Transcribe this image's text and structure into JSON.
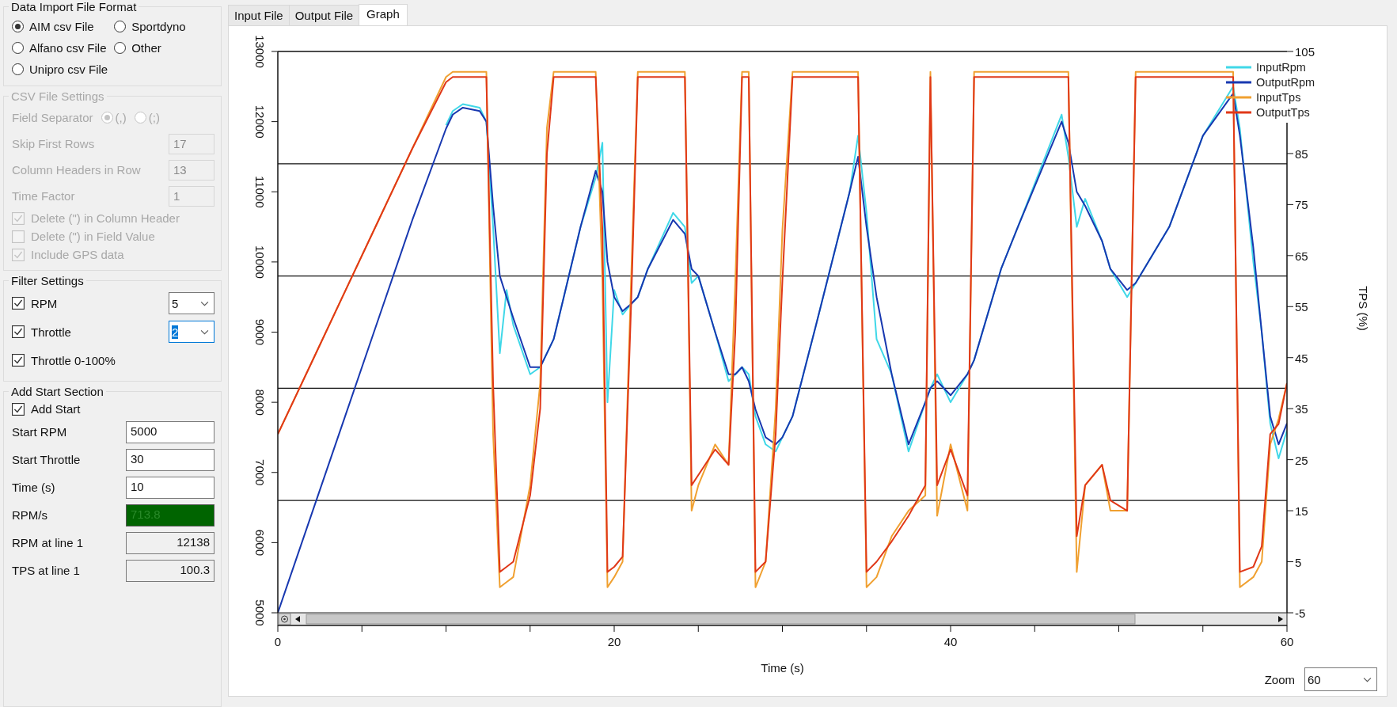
{
  "import_format": {
    "title": "Data Import File Format",
    "options": [
      {
        "label": "AIM csv File",
        "selected": true
      },
      {
        "label": "Sportdyno",
        "selected": false
      },
      {
        "label": "Alfano csv File",
        "selected": false
      },
      {
        "label": "Other",
        "selected": false
      },
      {
        "label": "Unipro csv File",
        "selected": false
      }
    ]
  },
  "csv_settings": {
    "title": "CSV File Settings",
    "disabled": true,
    "field_separator": {
      "label": "Field Separator",
      "options": [
        {
          "label": "(,)",
          "selected": true
        },
        {
          "label": "(;)",
          "selected": false
        }
      ]
    },
    "fields": [
      {
        "label": "Skip First Rows",
        "value": "17"
      },
      {
        "label": "Column Headers in Row",
        "value": "13"
      },
      {
        "label": "Time Factor",
        "value": "1"
      }
    ],
    "checkboxes": [
      {
        "label": "Delete (\") in Column Header",
        "checked": true
      },
      {
        "label": "Delete (\") in Field Value",
        "checked": false
      },
      {
        "label": "Include GPS data",
        "checked": true
      }
    ]
  },
  "filter_settings": {
    "title": "Filter Settings",
    "rows": [
      {
        "label": "RPM",
        "checked": true,
        "value": "5",
        "focused": false
      },
      {
        "label": "Throttle",
        "checked": true,
        "value": "2",
        "focused": true
      },
      {
        "label": "Throttle 0-100%",
        "checked": true
      }
    ]
  },
  "start_section": {
    "title": "Add Start Section",
    "add_start": {
      "label": "Add Start",
      "checked": true
    },
    "fields": [
      {
        "label": "Start RPM",
        "value": "5000",
        "kind": "input"
      },
      {
        "label": "Start Throttle",
        "value": "30",
        "kind": "input"
      },
      {
        "label": "Time (s)",
        "value": "10",
        "kind": "input"
      },
      {
        "label": "RPM/s",
        "value": "713.8",
        "kind": "highlight"
      },
      {
        "label": "RPM at line 1",
        "value": "12138",
        "kind": "readonly"
      },
      {
        "label": "TPS at line 1",
        "value": "100.3",
        "kind": "readonly"
      }
    ]
  },
  "tabs": [
    {
      "label": "Input File",
      "selected": false
    },
    {
      "label": "Output File",
      "selected": false
    },
    {
      "label": "Graph",
      "selected": true
    }
  ],
  "graph": {
    "chart_data": {
      "type": "line",
      "legend": "top-right",
      "xlabel": "Time (s)",
      "y2label": "TPS (%)",
      "xlim": [
        0,
        60
      ],
      "xticks": [
        0,
        20,
        40,
        60
      ],
      "ylim": [
        5000,
        13000
      ],
      "yticks": [
        5000,
        6000,
        7000,
        8000,
        9000,
        10000,
        11000,
        12000,
        13000
      ],
      "y2lim": [
        -5,
        105
      ],
      "y2ticks": [
        -5,
        5,
        15,
        25,
        35,
        45,
        55,
        65,
        75,
        85,
        105
      ],
      "x": [
        0,
        2,
        4,
        6,
        8,
        10,
        10.4,
        11,
        12,
        12.4,
        12.8,
        13.2,
        13.6,
        14,
        15,
        15.6,
        16,
        16.4,
        17,
        18,
        18.9,
        19.3,
        19.6,
        20,
        20.5,
        21,
        21.4,
        22,
        23.5,
        24.2,
        24.6,
        25,
        26,
        26.8,
        27.2,
        27.6,
        28,
        28.4,
        29,
        29.6,
        30,
        30.6,
        32,
        34,
        34.5,
        35,
        35.6,
        36.5,
        37.5,
        38.5,
        38.8,
        39.2,
        40,
        41,
        41.4,
        43,
        44,
        46.6,
        47,
        47.5,
        48,
        49,
        49.5,
        50.5,
        51,
        53,
        55,
        56.8,
        57.2,
        58,
        58.5,
        59,
        59.5,
        60
      ],
      "series": [
        {
          "name": "InputRpm",
          "color": "#40d8e8",
          "values": [
            null,
            null,
            null,
            null,
            null,
            11950,
            12150,
            12250,
            12200,
            12000,
            10500,
            8700,
            9600,
            9100,
            8400,
            8500,
            8700,
            8900,
            9500,
            10500,
            11200,
            11700,
            8000,
            9600,
            9250,
            9400,
            9500,
            9900,
            10700,
            10500,
            9700,
            9800,
            9000,
            8300,
            8400,
            8500,
            8400,
            7800,
            7400,
            7300,
            7500,
            7800,
            9100,
            11000,
            11800,
            10700,
            8900,
            8400,
            7300,
            8000,
            8200,
            8400,
            8000,
            8400,
            8600,
            9900,
            10500,
            12100,
            11500,
            10500,
            10900,
            10300,
            9900,
            9500,
            9700,
            10500,
            11800,
            12500,
            11900,
            10000,
            9000,
            7700,
            7200,
            7600
          ]
        },
        {
          "name": "OutputRpm",
          "color": "#1838b0",
          "values": [
            5000,
            6400,
            7800,
            9200,
            10600,
            11900,
            12100,
            12200,
            12150,
            12000,
            10800,
            9800,
            9500,
            9200,
            8500,
            8500,
            8700,
            8900,
            9500,
            10500,
            11300,
            11000,
            10000,
            9500,
            9300,
            9400,
            9500,
            9900,
            10600,
            10400,
            9900,
            9800,
            9000,
            8400,
            8400,
            8500,
            8300,
            7900,
            7500,
            7400,
            7500,
            7800,
            9100,
            11000,
            11500,
            10500,
            9500,
            8400,
            7400,
            8000,
            8200,
            8300,
            8100,
            8400,
            8600,
            9900,
            10500,
            12000,
            11700,
            11000,
            10800,
            10300,
            9900,
            9600,
            9700,
            10500,
            11800,
            12400,
            11800,
            10200,
            9000,
            7800,
            7400,
            7700
          ]
        },
        {
          "name": "InputTps",
          "color": "#f0a030",
          "axis": "y2",
          "values": [
            30,
            44,
            58,
            72,
            86,
            100,
            101,
            101,
            101,
            101,
            30,
            0,
            1,
            2,
            20,
            40,
            90,
            101,
            101,
            101,
            101,
            60,
            0,
            2,
            5,
            60,
            101,
            101,
            101,
            101,
            15,
            20,
            28,
            24,
            60,
            101,
            101,
            0,
            5,
            35,
            70,
            101,
            101,
            101,
            101,
            0,
            2,
            10,
            15,
            18,
            101,
            14,
            28,
            15,
            101,
            101,
            101,
            101,
            101,
            3,
            20,
            24,
            15,
            15,
            101,
            101,
            101,
            101,
            0,
            2,
            5,
            28,
            33,
            40
          ]
        },
        {
          "name": "OutputTps",
          "color": "#e03818",
          "axis": "y2",
          "values": [
            30,
            44,
            58,
            72,
            86,
            99,
            100,
            100,
            100,
            100,
            40,
            3,
            4,
            5,
            18,
            35,
            85,
            100,
            100,
            100,
            100,
            70,
            3,
            4,
            6,
            55,
            100,
            100,
            100,
            100,
            20,
            22,
            27,
            24,
            50,
            100,
            100,
            3,
            5,
            30,
            60,
            100,
            100,
            100,
            100,
            3,
            5,
            9,
            14,
            20,
            100,
            20,
            27,
            18,
            100,
            100,
            100,
            100,
            100,
            10,
            20,
            24,
            17,
            15,
            100,
            100,
            100,
            100,
            3,
            4,
            8,
            30,
            32,
            40
          ]
        }
      ]
    },
    "zoom": {
      "label": "Zoom",
      "value": "60"
    }
  }
}
